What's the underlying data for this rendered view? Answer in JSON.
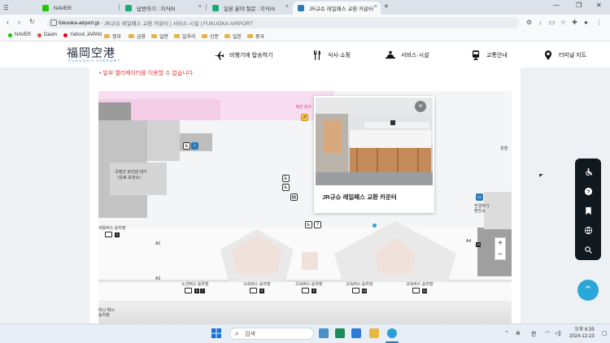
{
  "browser": {
    "tabs": [
      {
        "title": "NAVER",
        "active": false,
        "fav_color": "#1ec800"
      },
      {
        "title": "답변하기 : 지식iN",
        "active": false,
        "fav_color": "#19a974"
      },
      {
        "title": "일본 분야 질문 : 지식iN",
        "active": false,
        "fav_color": "#19a974"
      },
      {
        "title": "JR규슈 레일패스 교환 카운터",
        "active": true,
        "fav_color": "#2a7ab8"
      }
    ],
    "url_domain": "fukuoka-airport.jp",
    "url_rest": "JR규슈 레일패스 교환 카운터 | 서비스·시설 | FUKUOKA AIRPORT",
    "bookmarks": [
      {
        "label": "NAVER",
        "kind": "dot",
        "color": "#1ec800"
      },
      {
        "label": "Daum",
        "kind": "dot",
        "color": "#e24b3b"
      },
      {
        "label": "Yahoo! JAPAN",
        "kind": "dot",
        "color": "#e60012"
      },
      {
        "label": "정부",
        "kind": "folder"
      },
      {
        "label": "금융",
        "kind": "folder"
      },
      {
        "label": "일반",
        "kind": "folder"
      },
      {
        "label": "일자리",
        "kind": "folder"
      },
      {
        "label": "신문",
        "kind": "folder"
      },
      {
        "label": "일본",
        "kind": "folder"
      },
      {
        "label": "중국",
        "kind": "folder"
      }
    ]
  },
  "site": {
    "logo": "福岡空港",
    "logo_sub": "FUKUOKA AIRPORT",
    "nav": [
      {
        "label": "비행기에 탑승하기",
        "icon": "airplane-icon"
      },
      {
        "label": "식사·쇼핑",
        "icon": "fork-knife-icon"
      },
      {
        "label": "서비스·시설",
        "icon": "service-icon"
      },
      {
        "label": "교통안내",
        "icon": "train-icon"
      },
      {
        "label": "터미널 지도",
        "icon": "map-pin-icon"
      }
    ],
    "notice": "• 일부 엘리베이터를 이용할 수 없습니다."
  },
  "map": {
    "labels": {
      "customs": "세관 검사",
      "bus_left": "국제선 보안검 대기",
      "bus_left2": "(유료 보관소)",
      "kanjou": "관청",
      "bus_stop_left": "셔틀버스 승차장",
      "right_box": "연결하기",
      "right_box2": "환전소",
      "taxi": "미니 택시",
      "taxi2": "승차장"
    },
    "gates": [
      "A2",
      "A3",
      "A4"
    ],
    "bus_stops": [
      {
        "label": "노선버스 승차장",
        "nums": [
          "6",
          "7"
        ]
      },
      {
        "label": "고속버스 승차장",
        "nums": [
          "8"
        ]
      },
      {
        "label": "고속버스 승차장",
        "nums": [
          "9"
        ]
      },
      {
        "label": "고속버스 승차장",
        "nums": [
          "10"
        ]
      },
      {
        "label": "고속버스 승차장",
        "nums": [
          "11"
        ]
      }
    ],
    "left_stop_num": "5",
    "right_num": "12",
    "zoom_in": "+",
    "zoom_out": "−"
  },
  "popup": {
    "title": "JR규슈 레일패스 교환 카운터",
    "close": "×"
  },
  "taskbar": {
    "search_placeholder": "검색",
    "lang": "한",
    "time": "오후 6:35",
    "date": "2024-12-23"
  },
  "colors": {
    "accent": "#2aa7d9",
    "notice": "#e23a3a",
    "pink_zone": "#f8dcef",
    "dark_panel": "#101820"
  }
}
